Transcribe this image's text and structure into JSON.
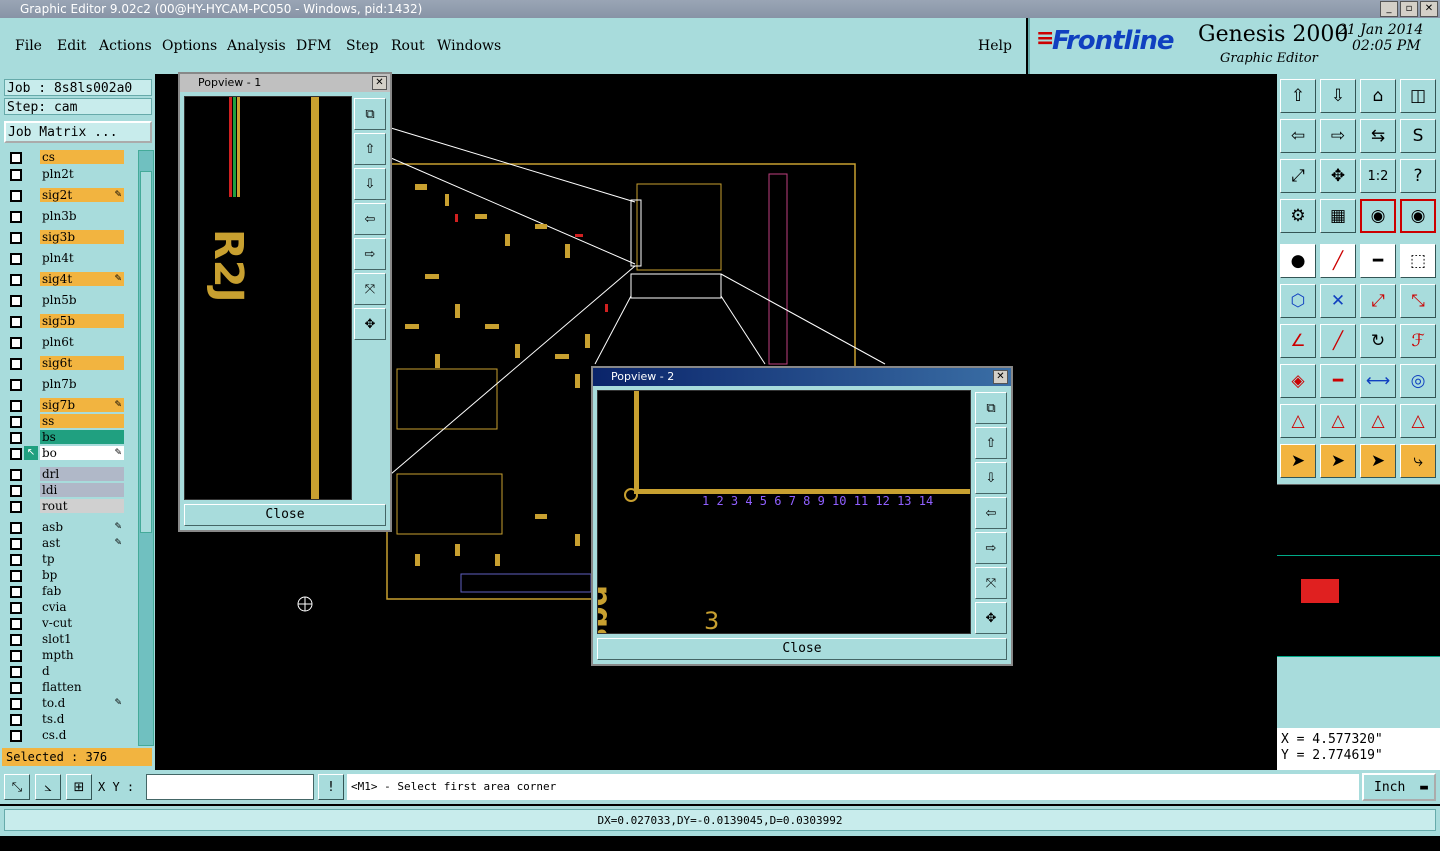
{
  "window": {
    "title": "Graphic Editor 9.02c2 (00@HY-HYCAM-PC050 - Windows, pid:1432)"
  },
  "menu": [
    "File",
    "Edit",
    "Actions",
    "Options",
    "Analysis",
    "DFM",
    "Step",
    "Rout",
    "Windows"
  ],
  "help": "Help",
  "brand": {
    "logo": "Frontline",
    "product": "Genesis 2000",
    "subtitle": "Graphic Editor",
    "date": "21 Jan 2014",
    "time": "02:05 PM"
  },
  "job": {
    "job_label": "Job : 8s8ls002a0",
    "step_label": "Step: cam",
    "matrix_button": "Job Matrix ..."
  },
  "layers": [
    {
      "name": "cs",
      "color": "#f2b440"
    },
    {
      "name": "pln2t",
      "color": "#a8dcdc"
    },
    {
      "name": "sig2t",
      "color": "#f2b440"
    },
    {
      "name": "pln3b",
      "color": "#a8dcdc"
    },
    {
      "name": "sig3b",
      "color": "#f2b440"
    },
    {
      "name": "pln4t",
      "color": "#a8dcdc"
    },
    {
      "name": "sig4t",
      "color": "#f2b440"
    },
    {
      "name": "pln5b",
      "color": "#a8dcdc"
    },
    {
      "name": "sig5b",
      "color": "#f2b440"
    },
    {
      "name": "pln6t",
      "color": "#a8dcdc"
    },
    {
      "name": "sig6t",
      "color": "#f2b440"
    },
    {
      "name": "pln7b",
      "color": "#a8dcdc"
    },
    {
      "name": "sig7b",
      "color": "#f2b440"
    },
    {
      "name": "ss",
      "color": "#f2b440"
    },
    {
      "name": "bs",
      "color": "#20a080"
    },
    {
      "name": "bo",
      "color": "#ffffff"
    },
    {
      "name": "drl",
      "color": "#b0b8c8"
    },
    {
      "name": "ldi",
      "color": "#b0b8c8"
    },
    {
      "name": "rout",
      "color": "#d0d0d0"
    },
    {
      "name": "asb",
      "color": "#a8dcdc"
    },
    {
      "name": "ast",
      "color": "#a8dcdc"
    },
    {
      "name": "tp",
      "color": "#a8dcdc"
    },
    {
      "name": "bp",
      "color": "#a8dcdc"
    },
    {
      "name": "fab",
      "color": "#a8dcdc"
    },
    {
      "name": "cvia",
      "color": "#a8dcdc"
    },
    {
      "name": "v-cut",
      "color": "#a8dcdc"
    },
    {
      "name": "slot1",
      "color": "#a8dcdc"
    },
    {
      "name": "mpth",
      "color": "#a8dcdc"
    },
    {
      "name": "d",
      "color": "#a8dcdc"
    },
    {
      "name": "flatten",
      "color": "#a8dcdc"
    },
    {
      "name": "to.d",
      "color": "#a8dcdc"
    },
    {
      "name": "ts.d",
      "color": "#a8dcdc"
    },
    {
      "name": "cs.d",
      "color": "#a8dcdc"
    }
  ],
  "selected": "Selected : 376",
  "popview1": {
    "title": "Popview - 1",
    "close": "Close"
  },
  "popview2": {
    "title": "Popview - 2",
    "close": "Close"
  },
  "coords": {
    "x": "X = 4.577320\"",
    "y": "Y = 2.774619\""
  },
  "bottom": {
    "xy_label": "X Y :",
    "xy_value": "",
    "prompt": "<M1> - Select first area corner",
    "units": "Inch",
    "measure": "DX=0.027033,DY=-0.0139045,D=0.0303992"
  },
  "colors": {
    "panel": "#a8dcdc",
    "layer_signal": "#f2b440",
    "canvas": "#000000",
    "pcb_trace": "#c8a030"
  }
}
